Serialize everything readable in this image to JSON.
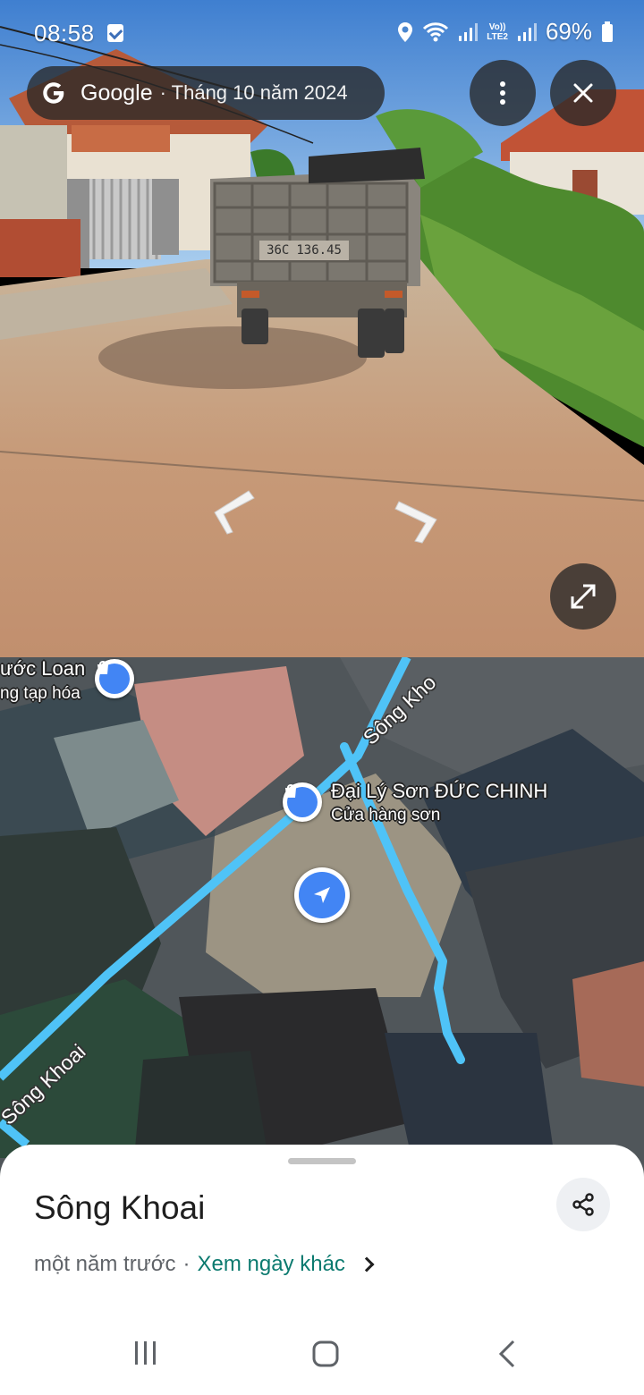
{
  "status_bar": {
    "time": "08:58",
    "battery": "69%",
    "network_label": "LTE2",
    "volte_label": "Vo))"
  },
  "streetview": {
    "brand": "Google",
    "date": "· Tháng 10 năm 2024",
    "plate_left": "36C",
    "plate_right": "136.45",
    "icons": {
      "logo": "google-g-icon",
      "more": "more-vert-icon",
      "close": "close-icon",
      "expand": "expand-icon"
    }
  },
  "map": {
    "pois": [
      {
        "name": "ước Loan",
        "category": "ng tạp hóa"
      },
      {
        "name": "Đại Lý Sơn ĐỨC CHINH",
        "category": "Cửa hàng sơn"
      }
    ],
    "roads": [
      "Sông Khoai",
      "Sông Kho"
    ],
    "colors": {
      "road": "#4fc3f7",
      "pin": "#4285f4"
    }
  },
  "sheet": {
    "title": "Sông Khoai",
    "age": "một năm trước",
    "separator": "·",
    "link": "Xem ngày khác"
  }
}
